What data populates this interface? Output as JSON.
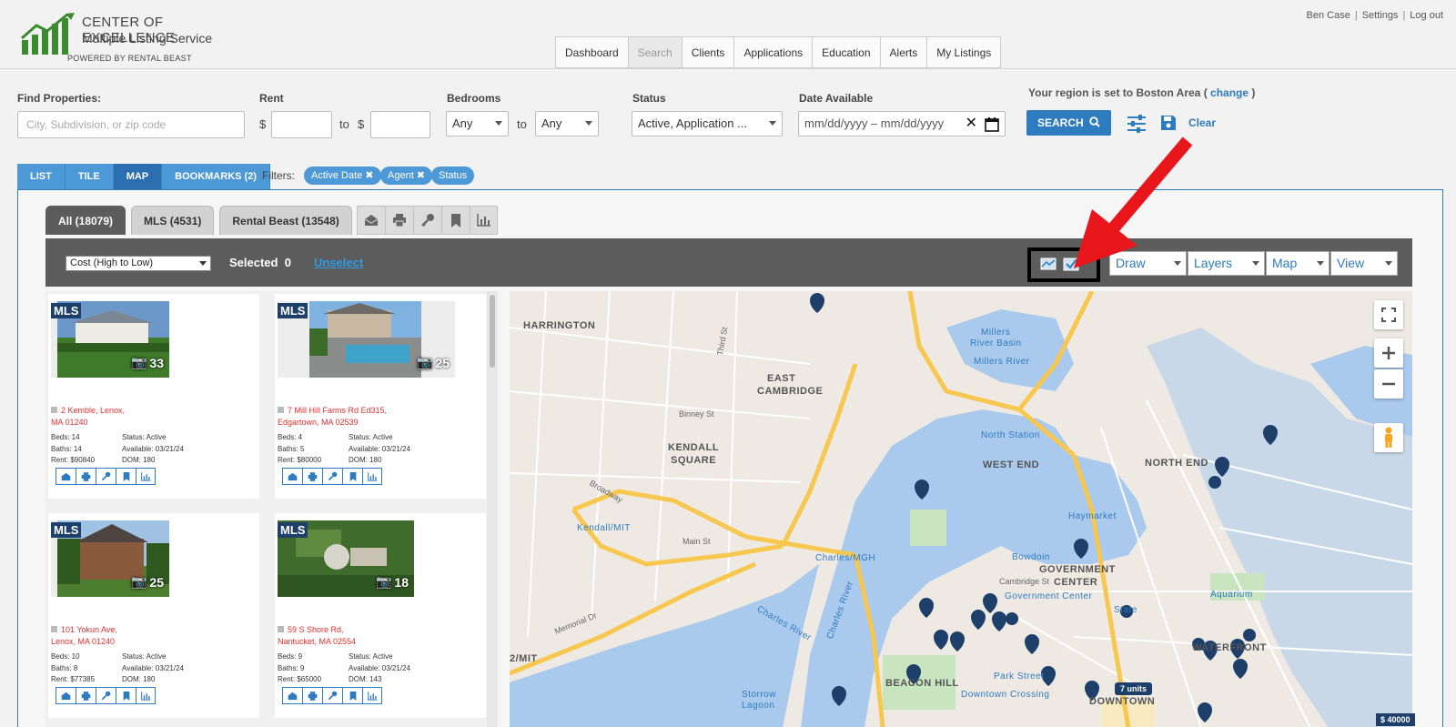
{
  "brand": {
    "line1": "CENTER OF EXCELLENCE",
    "line2": "Multiple Listing Service",
    "line3": "POWERED BY RENTAL BEAST",
    "color": "#3a8a2e"
  },
  "user_links": [
    "Ben Case",
    "Settings",
    "Log out"
  ],
  "nav": {
    "tabs": [
      "Dashboard",
      "Search",
      "Clients",
      "Applications",
      "Education",
      "Alerts",
      "My Listings"
    ],
    "active": "Search"
  },
  "search": {
    "find_label": "Find Properties:",
    "find_placeholder": "City, Subdivision, or zip code",
    "rent_label": "Rent",
    "currency": "$",
    "to": "to",
    "bedrooms_label": "Bedrooms",
    "bed_min": "Any",
    "bed_max": "Any",
    "status_label": "Status",
    "status_value": "Active, Application ...",
    "date_label": "Date Available",
    "date_value": "mm/dd/yyyy – mm/dd/yyyy",
    "region_text": "Your region is set to Boston Area (",
    "region_change": "change",
    "region_close": ")",
    "search_button": "SEARCH",
    "clear_label": "Clear"
  },
  "view_tabs": [
    "LIST",
    "TILE",
    "MAP",
    "BOOKMARKS (2)"
  ],
  "active_view": "MAP",
  "filters": {
    "label": "Filters:",
    "chips": [
      "Active Date ✖",
      "Agent ✖",
      "Status"
    ]
  },
  "source_tabs": [
    "All (18079)",
    "MLS (4531)",
    "Rental Beast (13548)"
  ],
  "toolbar": {
    "sort_value": "Cost (High to Low)",
    "selected_label": "Selected",
    "selected_count": "0",
    "unselect_label": "Unselect",
    "draw_label": "Draw",
    "layers_label": "Layers",
    "map_label": "Map",
    "view_label": "View"
  },
  "listings": [
    {
      "badge": "MLS",
      "photos": "33",
      "addr1": "2 Kemble, Lenox,",
      "addr2": "MA 01240",
      "beds": "Beds: 14",
      "status": "Status: Active",
      "baths": "Baths: 14",
      "available": "Available: 03/21/24",
      "rent": "Rent: $90840",
      "dom": "DOM: 180"
    },
    {
      "badge": "MLS",
      "photos": "25",
      "addr1": "7 Mill Hill Farms Rd Ed315,",
      "addr2": "Edgartown, MA 02539",
      "beds": "Beds: 4",
      "status": "Status: Active",
      "baths": "Baths: 5",
      "available": "Available: 03/21/24",
      "rent": "Rent: $80000",
      "dom": "DOM: 180"
    },
    {
      "badge": "MLS",
      "photos": "25",
      "addr1": "101 Yokun Ave,",
      "addr2": "Lenox, MA 01240",
      "beds": "Beds: 10",
      "status": "Status: Active",
      "baths": "Baths: 8",
      "available": "Available: 03/21/24",
      "rent": "Rent: $77385",
      "dom": "DOM: 180"
    },
    {
      "badge": "MLS",
      "photos": "18",
      "addr1": "59 S Shore Rd,",
      "addr2": "Nantucket, MA 02554",
      "beds": "Beds: 9",
      "status": "Status: Active",
      "baths": "Baths: 9",
      "available": "Available: 03/21/24",
      "rent": "Rent: $65000",
      "dom": "DOM: 143"
    }
  ],
  "map": {
    "labels": {
      "harrington": "HARRINGTON",
      "east_cambridge": "EAST",
      "east_cambridge2": "CAMBRIDGE",
      "kendall": "KENDALL",
      "kendall2": "SQUARE",
      "west_end": "WEST END",
      "north_end": "NORTH END",
      "gov_center": "GOVERNMENT",
      "gov_center2": "CENTER",
      "beacon_hill": "BEACON HILL",
      "downtown": "DOWNTOWN",
      "waterfront": "WATERFRONT",
      "millers_basin": "Millers",
      "millers_basin2": "River Basin",
      "millers_river": "Millers River",
      "charles_river": "Charles River",
      "charles_river2": "Charles River",
      "north_station": "North Station",
      "haymarket": "Haymarket",
      "kendall_mit": "Kendall/MIT",
      "charles_mgh": "Charles/MGH",
      "bowdoin": "Bowdoin",
      "gov_center_stn": "Government Center",
      "state": "State",
      "aquarium": "Aquarium",
      "park_street": "Park Street",
      "downtown_crossing": "Downtown Crossing",
      "mit": "2/MIT",
      "storrow": "Storrow",
      "storrow2": "Lagoon",
      "cambridge_st": "Cambridge St",
      "main_st": "Main St",
      "broadway": "Broadway",
      "memorial_dr": "Memorial Dr",
      "third_st": "Third St",
      "binney": "Binney St"
    },
    "units_badge": "7 units",
    "price_badge": "$ 40000"
  },
  "colors": {
    "accent": "#2f7bbf",
    "marker": "#1f3f6b",
    "address_red": "#e03030",
    "toolbar_bg": "#5c5c5c",
    "arrow_red": "#e8161b",
    "water": "#a9c9ed",
    "highway": "#f7c74f"
  }
}
